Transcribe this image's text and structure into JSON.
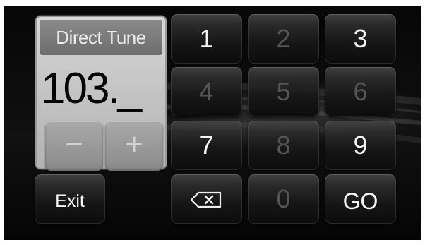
{
  "panel": {
    "title": "Direct Tune",
    "frequency": "103._",
    "minus_label": "−",
    "plus_label": "+"
  },
  "keypad": {
    "keys": [
      {
        "label": "1",
        "enabled": true
      },
      {
        "label": "2",
        "enabled": false
      },
      {
        "label": "3",
        "enabled": true
      },
      {
        "label": "4",
        "enabled": false
      },
      {
        "label": "5",
        "enabled": false
      },
      {
        "label": "6",
        "enabled": false
      },
      {
        "label": "7",
        "enabled": true
      },
      {
        "label": "8",
        "enabled": false
      },
      {
        "label": "9",
        "enabled": true
      },
      {
        "label": "0",
        "enabled": false
      }
    ],
    "backspace_icon": "backspace-icon",
    "go_label": "GO"
  },
  "exit_label": "Exit",
  "colors": {
    "enabled_text": "#f4f4f4",
    "disabled_text": "#555555",
    "panel_header": "#7a7a7a"
  }
}
